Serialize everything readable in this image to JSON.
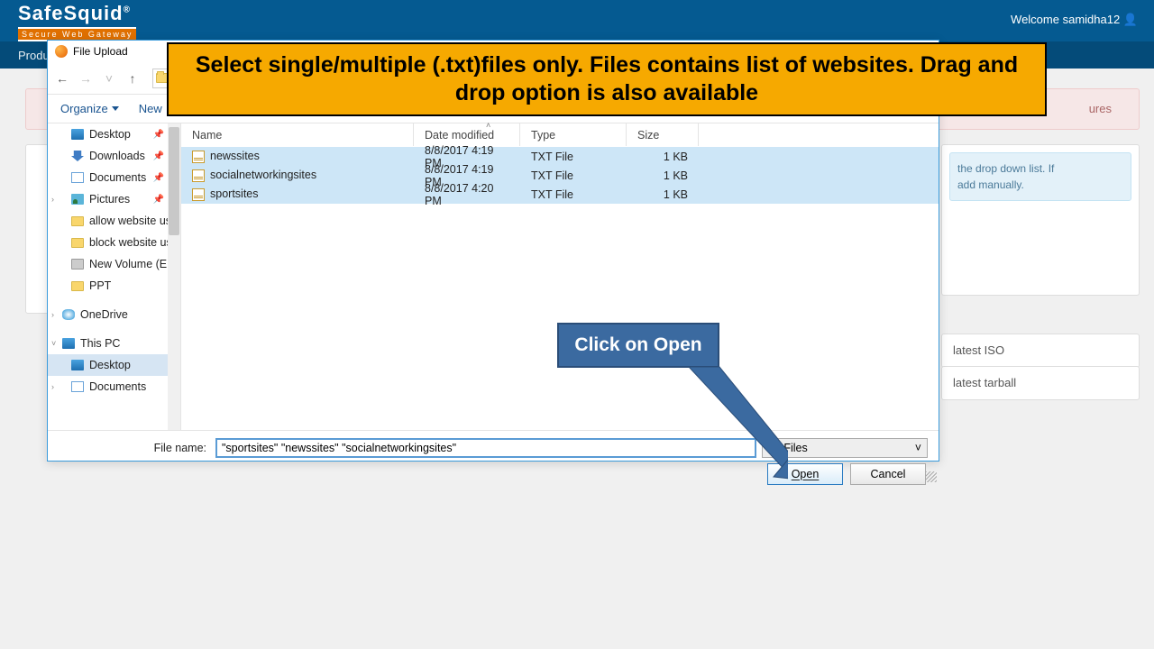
{
  "header": {
    "logo_main": "SafeSquid",
    "logo_reg": "®",
    "logo_sub": "Secure Web Gateway",
    "welcome": "Welcome samidha12",
    "user_icon": "👤"
  },
  "navbar": {
    "item1_prefix": "Produ"
  },
  "bg": {
    "alert_suffix": "ures",
    "info_line1": "the drop down list. If",
    "info_line2": "add manually.",
    "list1": "latest ISO",
    "list2": "latest tarball"
  },
  "dialog": {
    "title": "File Upload",
    "toolbar": {
      "organize": "Organize",
      "newfolder": "New"
    },
    "sidebar": [
      {
        "label": "Desktop",
        "icon": "desktop",
        "pin": true,
        "indent": true
      },
      {
        "label": "Downloads",
        "icon": "downloads",
        "pin": true,
        "indent": true
      },
      {
        "label": "Documents",
        "icon": "docs",
        "pin": true,
        "indent": true
      },
      {
        "label": "Pictures",
        "icon": "pics",
        "pin": true,
        "indent": true,
        "expand": ">"
      },
      {
        "label": "allow website us",
        "icon": "folder",
        "indent": true
      },
      {
        "label": "block website us",
        "icon": "folder",
        "indent": true
      },
      {
        "label": "New Volume (E:)",
        "icon": "drive",
        "indent": true
      },
      {
        "label": "PPT",
        "icon": "folder",
        "indent": true
      },
      {
        "label": "",
        "spacer": true
      },
      {
        "label": "OneDrive",
        "icon": "onedrive",
        "expand": ">"
      },
      {
        "label": "",
        "spacer": true
      },
      {
        "label": "This PC",
        "icon": "thispc",
        "expand": "v"
      },
      {
        "label": "Desktop",
        "icon": "desktop",
        "indent": true,
        "selected": true
      },
      {
        "label": "Documents",
        "icon": "docs",
        "indent": true,
        "expand": ">"
      }
    ],
    "columns": {
      "name": "Name",
      "date": "Date modified",
      "type": "Type",
      "size": "Size"
    },
    "files": [
      {
        "name": "newssites",
        "date": "8/8/2017 4:19 PM",
        "type": "TXT File",
        "size": "1 KB",
        "selected": true
      },
      {
        "name": "socialnetworkingsites",
        "date": "8/8/2017 4:19 PM",
        "type": "TXT File",
        "size": "1 KB",
        "selected": true
      },
      {
        "name": "sportsites",
        "date": "8/8/2017 4:20 PM",
        "type": "TXT File",
        "size": "1 KB",
        "selected": true
      }
    ],
    "footer": {
      "filename_label": "File name:",
      "filename_value": "\"sportsites\" \"newssites\" \"socialnetworkingsites\"",
      "filetype": "All Files",
      "open": "Open",
      "cancel": "Cancel"
    }
  },
  "annotations": {
    "top": "Select single/multiple (.txt)files only. Files contains list of websites. Drag and drop option is also available",
    "open": "Click on Open"
  }
}
